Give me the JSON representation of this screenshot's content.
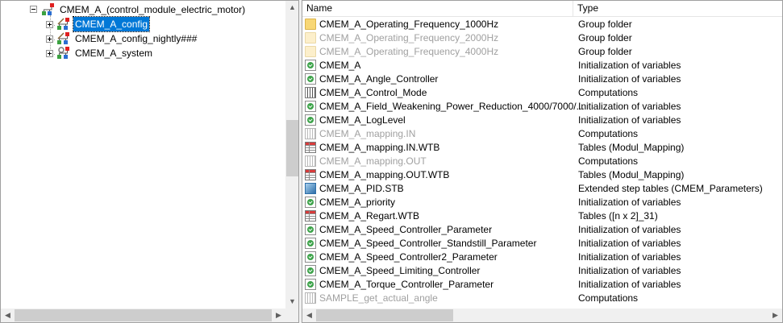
{
  "tree": {
    "root": {
      "label": "CMEM_A_(control_module_electric_motor)",
      "icon": "module-root-icon"
    },
    "children": [
      {
        "label": "CMEM_A_config",
        "icon": "config-icon",
        "selected": true
      },
      {
        "label": "CMEM_A_config_nightly###",
        "icon": "config-icon",
        "selected": false
      },
      {
        "label": "CMEM_A_system",
        "icon": "system-icon",
        "selected": false
      }
    ]
  },
  "list": {
    "columns": {
      "name": "Name",
      "type": "Type"
    },
    "rows": [
      {
        "name": "CMEM_A_Operating_Frequency_1000Hz",
        "type": "Group folder",
        "icon": "folder-icon",
        "dim": false
      },
      {
        "name": "CMEM_A_Operating_Frequency_2000Hz",
        "type": "Group folder",
        "icon": "folder-icon",
        "dim": true
      },
      {
        "name": "CMEM_A_Operating_Frequency_4000Hz",
        "type": "Group folder",
        "icon": "folder-icon",
        "dim": true
      },
      {
        "name": "CMEM_A",
        "type": "Initialization of variables",
        "icon": "init-icon",
        "dim": false
      },
      {
        "name": "CMEM_A_Angle_Controller",
        "type": "Initialization of variables",
        "icon": "init-icon",
        "dim": false
      },
      {
        "name": "CMEM_A_Control_Mode",
        "type": "Computations",
        "icon": "computation-icon",
        "dim": false
      },
      {
        "name": "CMEM_A_Field_Weakening_Power_Reduction_4000/7000/...",
        "type": "Initialization of variables",
        "icon": "init-icon",
        "dim": false
      },
      {
        "name": "CMEM_A_LogLevel",
        "type": "Initialization of variables",
        "icon": "init-icon",
        "dim": false
      },
      {
        "name": "CMEM_A_mapping.IN",
        "type": "Computations",
        "icon": "computation-icon",
        "dim": true
      },
      {
        "name": "CMEM_A_mapping.IN.WTB",
        "type": "Tables (Modul_Mapping)",
        "icon": "table-icon",
        "dim": false
      },
      {
        "name": "CMEM_A_mapping.OUT",
        "type": "Computations",
        "icon": "computation-icon",
        "dim": true
      },
      {
        "name": "CMEM_A_mapping.OUT.WTB",
        "type": "Tables (Modul_Mapping)",
        "icon": "table-icon",
        "dim": false
      },
      {
        "name": "CMEM_A_PID.STB",
        "type": "Extended step tables (CMEM_Parameters)",
        "icon": "step-table-icon",
        "dim": false
      },
      {
        "name": "CMEM_A_priority",
        "type": "Initialization of variables",
        "icon": "init-icon",
        "dim": false
      },
      {
        "name": "CMEM_A_Regart.WTB",
        "type": "Tables ([n x 2]_31)",
        "icon": "table-icon",
        "dim": false
      },
      {
        "name": "CMEM_A_Speed_Controller_Parameter",
        "type": "Initialization of variables",
        "icon": "init-icon",
        "dim": false
      },
      {
        "name": "CMEM_A_Speed_Controller_Standstill_Parameter",
        "type": "Initialization of variables",
        "icon": "init-icon",
        "dim": false
      },
      {
        "name": "CMEM_A_Speed_Controller2_Parameter",
        "type": "Initialization of variables",
        "icon": "init-icon",
        "dim": false
      },
      {
        "name": "CMEM_A_Speed_Limiting_Controller",
        "type": "Initialization of variables",
        "icon": "init-icon",
        "dim": false
      },
      {
        "name": "CMEM_A_Torque_Controller_Parameter",
        "type": "Initialization of variables",
        "icon": "init-icon",
        "dim": false
      },
      {
        "name": "SAMPLE_get_actual_angle",
        "type": "Computations",
        "icon": "computation-icon",
        "dim": true
      }
    ]
  },
  "colors": {
    "selection": "#0078d7",
    "dim_text": "#a0a0a0"
  }
}
